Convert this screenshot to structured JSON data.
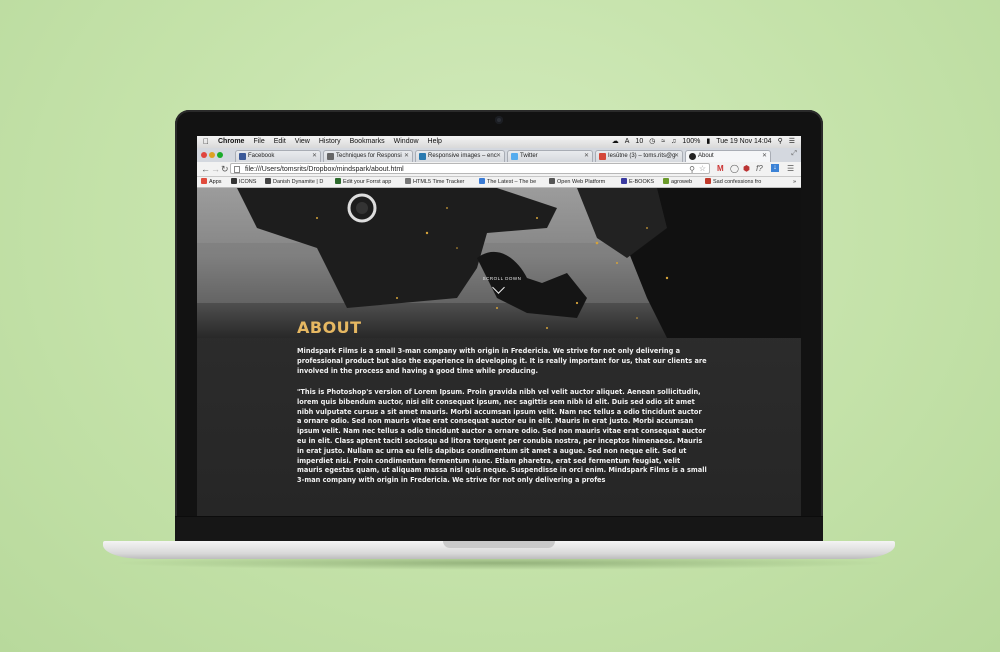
{
  "menubar": {
    "app_name": "Chrome",
    "menus": [
      "File",
      "Edit",
      "View",
      "History",
      "Bookmarks",
      "Window",
      "Help"
    ],
    "status_number": "10",
    "battery": "100%",
    "datetime": "Tue 19 Nov  14:04"
  },
  "tabs": [
    {
      "label": "Facebook",
      "favicon_color": "#3b5998"
    },
    {
      "label": "Techniques for Responsi",
      "favicon_color": "#666666"
    },
    {
      "label": "Responsive images – enc",
      "favicon_color": "#2a7ab0"
    },
    {
      "label": "Twitter",
      "favicon_color": "#55acee"
    },
    {
      "label": "Iesūtne (3) – toms.rits@g",
      "favicon_color": "#d44638"
    },
    {
      "label": "About",
      "favicon_color": "#222222"
    }
  ],
  "address_bar": {
    "url": "file:///Users/tomsrits/Dropbox/mindspark/about.html"
  },
  "bookmarks": [
    {
      "label": "Apps",
      "icon_color": "#e04b3c"
    },
    {
      "label": "ICONS",
      "icon_color": "#333333"
    },
    {
      "label": "Danish Dynamite | D",
      "icon_color": "#444444"
    },
    {
      "label": "Edit your Forrst app",
      "icon_color": "#2d6a2d"
    },
    {
      "label": "HTML5 Time Tracker",
      "icon_color": "#777777"
    },
    {
      "label": "The Latest – The be",
      "icon_color": "#3a7bd5"
    },
    {
      "label": "Open Web Platform",
      "icon_color": "#555555"
    },
    {
      "label": "E-BOOKS",
      "icon_color": "#3a3aa0"
    },
    {
      "label": "agroweb",
      "icon_color": "#6a9a2a"
    },
    {
      "label": "Sad confessions fro",
      "icon_color": "#c0392b"
    }
  ],
  "page": {
    "scroll_down": "SCROLL DOWN",
    "title": "About",
    "paragraph1": "Mindspark Films is a small 3-man company with origin in Fredericia. We strive for not only delivering a professional product but also the experience in developing it. It is really important for us, that our clients are involved in the process and having a good time while producing.",
    "paragraph2": "\"This is Photoshop's version of Lorem Ipsum. Proin gravida nibh vel velit auctor aliquet. Aenean sollicitudin, lorem quis bibendum auctor, nisi elit consequat ipsum, nec sagittis sem nibh id elit. Duis sed odio sit amet nibh vulputate cursus a sit amet mauris. Morbi accumsan ipsum velit. Nam nec tellus a odio tincidunt auctor a ornare odio. Sed non mauris vitae erat consequat auctor eu in elit. Mauris in erat justo. Morbi accumsan ipsum velit. Nam nec tellus a odio tincidunt auctor a ornare odio. Sed non mauris vitae erat consequat auctor eu in elit. Class aptent taciti sociosqu ad litora torquent per conubia nostra, per inceptos himenaeos. Mauris in erat justo. Nullam ac urna eu felis dapibus condimentum sit amet a augue. Sed non neque elit. Sed ut imperdiet nisi. Proin condimentum fermentum nunc. Etiam pharetra, erat sed fermentum feugiat, velit mauris egestas quam, ut aliquam massa nisl quis neque. Suspendisse in orci enim. Mindspark Films is a small 3-man company with origin in Fredericia. We strive for not only delivering a profes",
    "title_color": "#e6b862"
  }
}
